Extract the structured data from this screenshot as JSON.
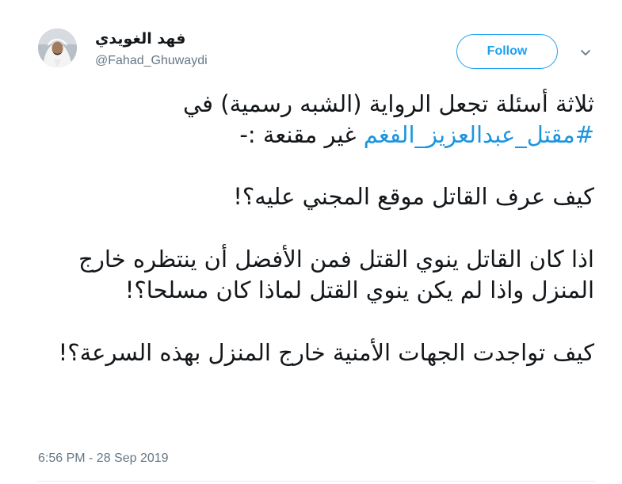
{
  "user": {
    "display_name": "فهد الغويدي",
    "handle": "@Fahad_Ghuwaydi",
    "avatar": "avatar-photo"
  },
  "follow_button": {
    "label": "Follow"
  },
  "caret": {
    "icon": "chevron-down-icon"
  },
  "tweet": {
    "para1_text": "ثلاثة أسئلة تجعل الرواية (الشبه رسمية) في",
    "hashtag": "#مقتل_عبدالعزيز_الفغم",
    "para1_tail": " غير مقنعة :-",
    "para2": "كيف عرف القاتل موقع المجني عليه؟!",
    "para3": "اذا كان القاتل ينوي القتل فمن الأفضل أن ينتظره خارج المنزل واذا لم يكن ينوي القتل لماذا كان مسلحا؟!",
    "para4": "كيف تواجدت الجهات الأمنية خارج المنزل بهذه السرعة؟!"
  },
  "timestamp": "6:56 PM - 28 Sep 2019",
  "colors": {
    "accent": "#1da1f2",
    "hashtag": "#1b95e0",
    "muted": "#657786",
    "text": "#14171a"
  }
}
